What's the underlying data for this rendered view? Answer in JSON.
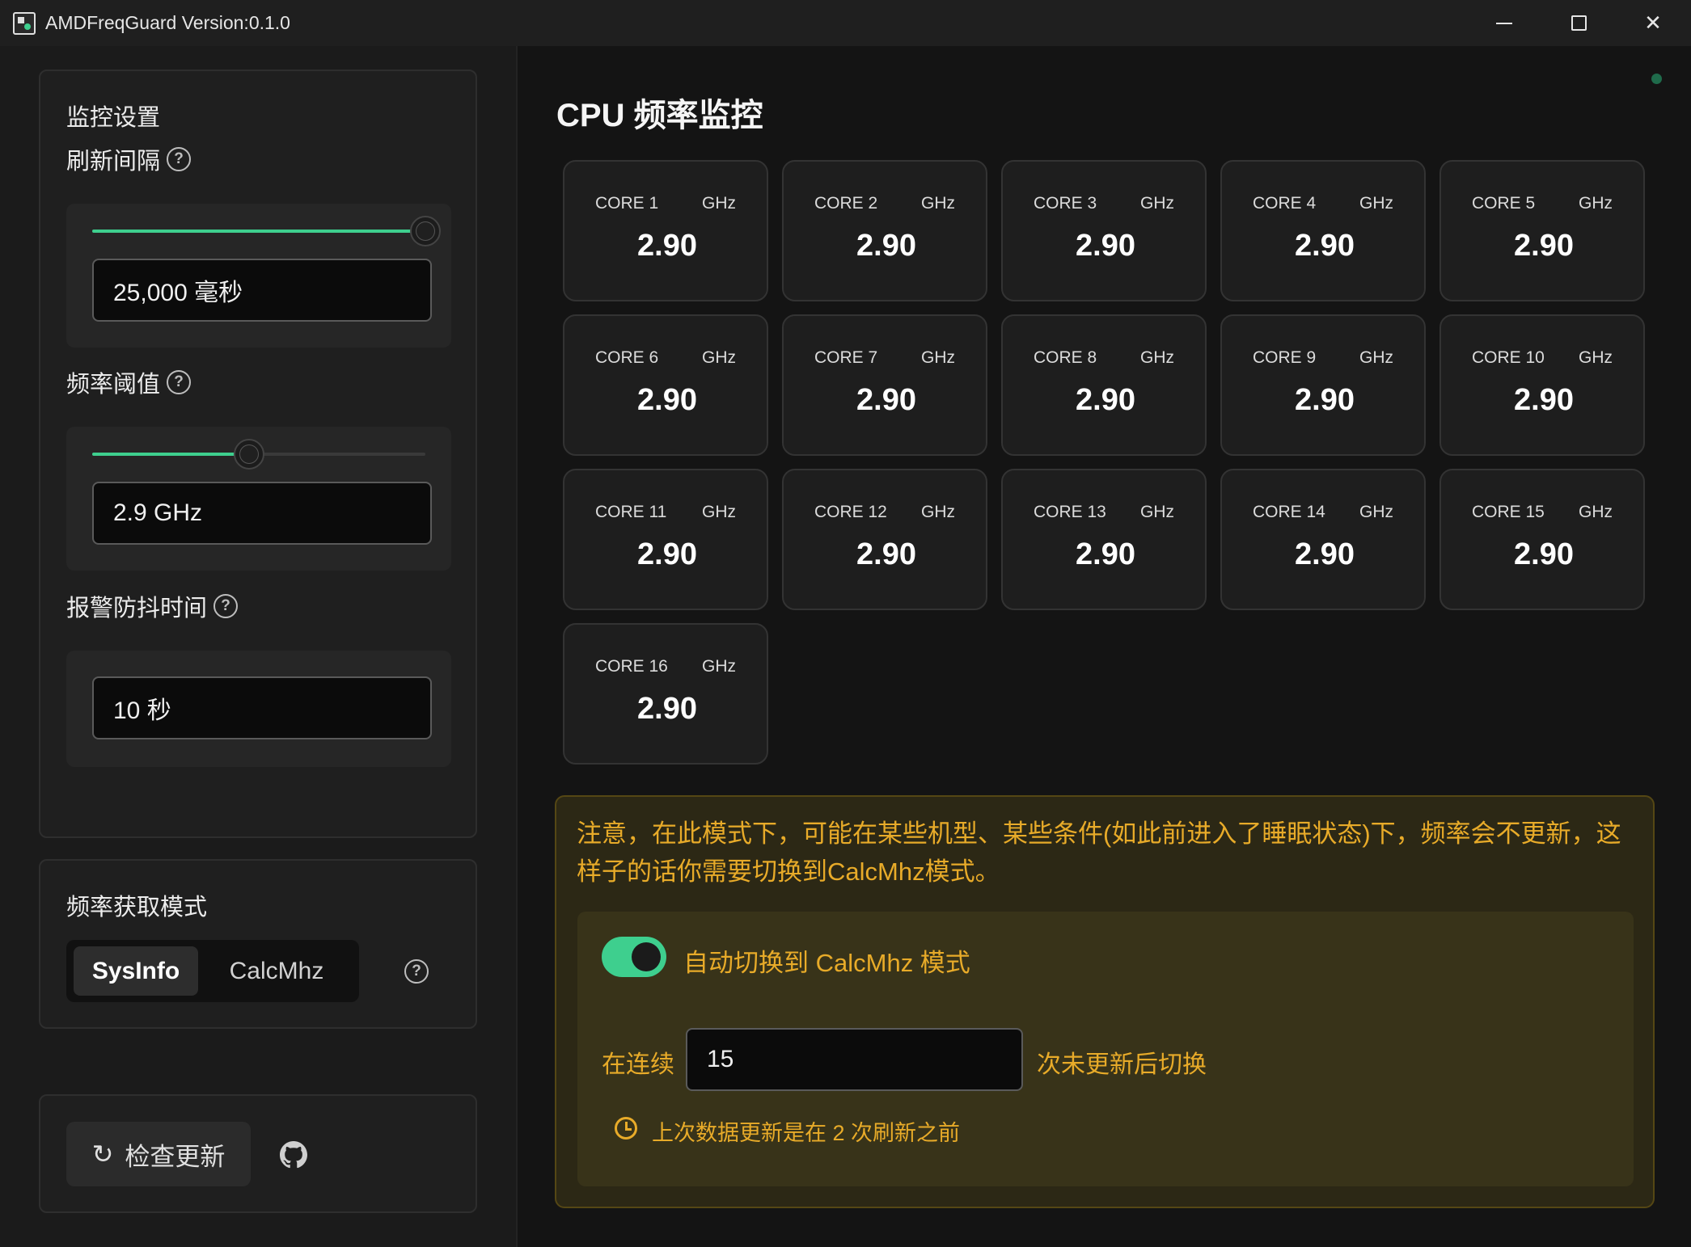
{
  "window": {
    "title": "AMDFreqGuard Version:0.1.0",
    "controls": [
      "minimize",
      "maximize",
      "close"
    ]
  },
  "sidebar": {
    "monitor": {
      "title": "监控设置",
      "refresh": {
        "label": "刷新间隔",
        "value": "25,000 毫秒",
        "slider_fraction": 1.0
      },
      "threshold": {
        "label": "频率阈值",
        "value": "2.9 GHz",
        "slider_fraction": 0.47
      },
      "debounce": {
        "label": "报警防抖时间",
        "value": "10 秒"
      }
    },
    "mode": {
      "title": "频率获取模式",
      "options": [
        "SysInfo",
        "CalcMhz"
      ],
      "selected": "SysInfo"
    },
    "update": {
      "button_label": "检查更新"
    }
  },
  "main": {
    "title": "CPU 频率监控",
    "cores": [
      {
        "name": "CORE 1",
        "unit": "GHz",
        "value": "2.90"
      },
      {
        "name": "CORE 2",
        "unit": "GHz",
        "value": "2.90"
      },
      {
        "name": "CORE 3",
        "unit": "GHz",
        "value": "2.90"
      },
      {
        "name": "CORE 4",
        "unit": "GHz",
        "value": "2.90"
      },
      {
        "name": "CORE 5",
        "unit": "GHz",
        "value": "2.90"
      },
      {
        "name": "CORE 6",
        "unit": "GHz",
        "value": "2.90"
      },
      {
        "name": "CORE 7",
        "unit": "GHz",
        "value": "2.90"
      },
      {
        "name": "CORE 8",
        "unit": "GHz",
        "value": "2.90"
      },
      {
        "name": "CORE 9",
        "unit": "GHz",
        "value": "2.90"
      },
      {
        "name": "CORE 10",
        "unit": "GHz",
        "value": "2.90"
      },
      {
        "name": "CORE 11",
        "unit": "GHz",
        "value": "2.90"
      },
      {
        "name": "CORE 12",
        "unit": "GHz",
        "value": "2.90"
      },
      {
        "name": "CORE 13",
        "unit": "GHz",
        "value": "2.90"
      },
      {
        "name": "CORE 14",
        "unit": "GHz",
        "value": "2.90"
      },
      {
        "name": "CORE 15",
        "unit": "GHz",
        "value": "2.90"
      },
      {
        "name": "CORE 16",
        "unit": "GHz",
        "value": "2.90"
      }
    ],
    "warning": {
      "text": "注意，在此模式下，可能在某些机型、某些条件(如此前进入了睡眠状态)下，频率会不更新，这样子的话你需要切换到CalcMhz模式。",
      "auto_switch": {
        "enabled": true,
        "label": "自动切换到 CalcMhz 模式"
      },
      "count_prefix": "在连续",
      "count_value": "15",
      "count_suffix": "次未更新后切换",
      "last_update": "上次数据更新是在 2 次刷新之前"
    }
  },
  "colors": {
    "accent": "#3ecf8e",
    "warning": "#e8ab29",
    "background": "#141414"
  }
}
